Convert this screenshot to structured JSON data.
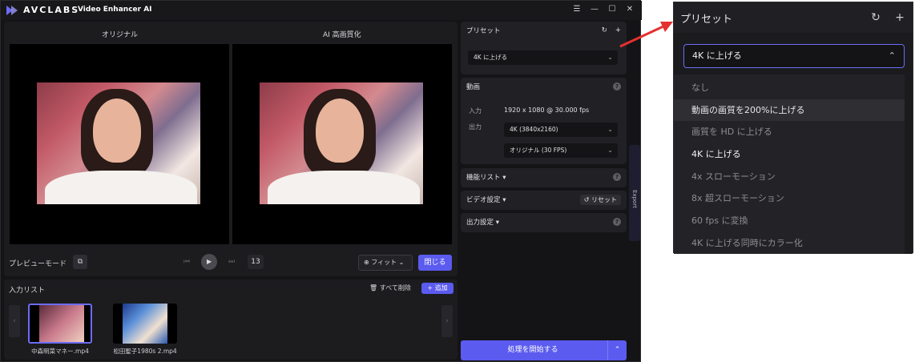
{
  "app": {
    "brand": "AVCLABS",
    "product": "Video Enhancer AI",
    "window_controls": [
      "☰",
      "—",
      "☐",
      "✕"
    ]
  },
  "preview": {
    "original_label": "オリジナル",
    "enhanced_label": "AI 高画質化",
    "mode_label": "プレビューモード",
    "frame_number": "13",
    "fit_label": "フィット",
    "close_label": "閉じる"
  },
  "input_list": {
    "title": "入力リスト",
    "delete_all_label": "すべて削除",
    "add_label": "+ 追加",
    "files": [
      {
        "name": "中森明菜マネー.mp4",
        "selected": true
      },
      {
        "name": "松田聖子1980s 2.mp4",
        "selected": false
      }
    ]
  },
  "settings": {
    "preset": {
      "title": "プリセット",
      "value": "4K に上げる"
    },
    "video": {
      "title": "動画",
      "input_key": "入力",
      "input_value": "1920 x 1080 @ 30.000 fps",
      "output_key": "出力",
      "resolution_value": "4K (3840x2160)",
      "fps_value": "オリジナル (30 FPS)"
    },
    "feature_list": {
      "title": "機能リスト"
    },
    "video_settings": {
      "title": "ビデオ設定",
      "reset_label": "リセット"
    },
    "output_settings": {
      "title": "出力設定"
    },
    "export_tab": "Export",
    "start_label": "処理を開始する"
  },
  "zoom": {
    "title": "プリセット",
    "selected": "4K に上げる",
    "options": [
      {
        "label": "なし",
        "state": "normal"
      },
      {
        "label": "動画の画質を200%に上げる",
        "state": "hover"
      },
      {
        "label": "画質を HD に上げる",
        "state": "normal"
      },
      {
        "label": "4K に上げる",
        "state": "active"
      },
      {
        "label": "4x スローモーション",
        "state": "normal"
      },
      {
        "label": "8x 超スローモーション",
        "state": "normal"
      },
      {
        "label": "60 fps に変換",
        "state": "normal"
      },
      {
        "label": "4K に上げる同時にカラー化",
        "state": "normal"
      }
    ]
  },
  "colors": {
    "accent": "#5b5bf0",
    "background": "#141416",
    "panel": "#1c1c1f",
    "callout_arrow": "#e53030"
  }
}
